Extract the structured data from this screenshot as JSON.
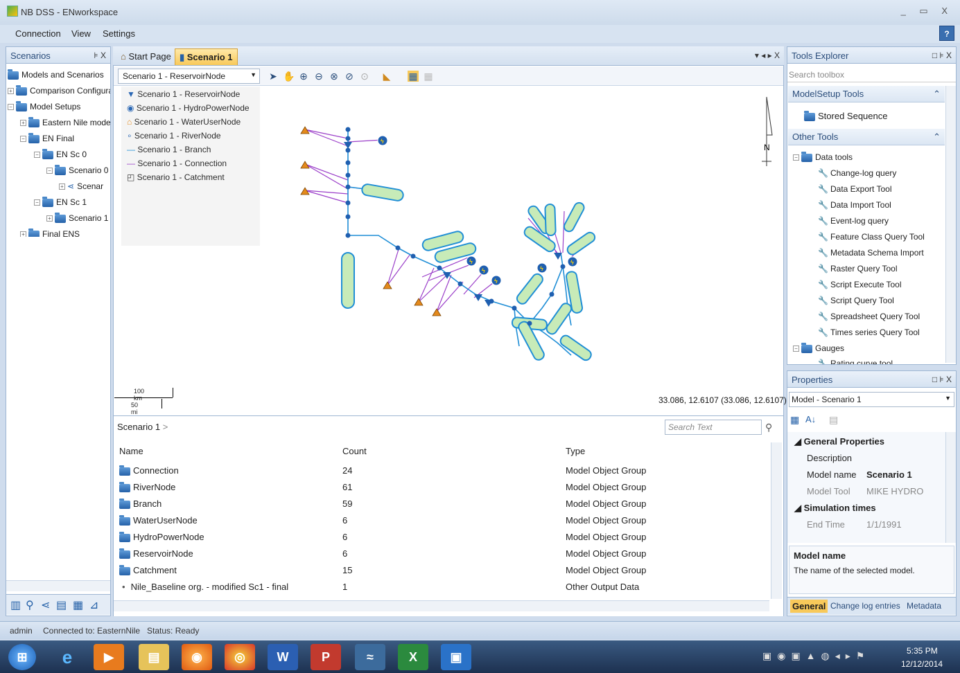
{
  "window": {
    "title": "NB DSS - ENworkspace",
    "controls": "_ ▭ X"
  },
  "menu": [
    "Connection",
    "View",
    "Settings"
  ],
  "help_label": "?",
  "scenarios_panel": {
    "title": "Scenarios",
    "pin": "⊧ X",
    "tree": [
      {
        "label": "Models and Scenarios"
      },
      {
        "label": "Comparison Configura"
      },
      {
        "label": "Model Setups"
      },
      {
        "label": "Eastern Nile mode"
      },
      {
        "label": "EN Final"
      },
      {
        "label": "EN Sc 0"
      },
      {
        "label": "Scenario 0"
      },
      {
        "label": "Scenar"
      },
      {
        "label": "EN Sc 1"
      },
      {
        "label": "Scenario 1"
      },
      {
        "label": "Final ENS"
      }
    ]
  },
  "tabs": {
    "start": "Start Page",
    "scenario": "Scenario 1"
  },
  "toolbar": {
    "layer_select": "Scenario 1 - ReservoirNode"
  },
  "legend": [
    {
      "icon": "reservoir-node-icon",
      "label": "Scenario 1 - ReservoirNode"
    },
    {
      "icon": "hydropower-node-icon",
      "label": "Scenario 1 - HydroPowerNode"
    },
    {
      "icon": "wateruser-node-icon",
      "label": "Scenario 1 - WaterUserNode"
    },
    {
      "icon": "river-node-icon",
      "label": "Scenario 1 - RiverNode"
    },
    {
      "icon": "branch-icon",
      "label": "Scenario 1 - Branch"
    },
    {
      "icon": "connection-icon",
      "label": "Scenario 1 - Connection"
    },
    {
      "icon": "catchment-icon",
      "label": "Scenario 1 - Catchment"
    }
  ],
  "map": {
    "north": "N",
    "scale_km": "100 km",
    "scale_mi": "50 mi",
    "coords": "33.086, 12.6107 (33.086, 12.6107)"
  },
  "list": {
    "breadcrumb": "Scenario 1",
    "breadcrumb_arrow": ">",
    "search_placeholder": "Search Text",
    "columns": {
      "name": "Name",
      "count": "Count",
      "type": "Type"
    },
    "rows": [
      {
        "name": "Connection",
        "count": "24",
        "type": "Model Object Group"
      },
      {
        "name": "RiverNode",
        "count": "61",
        "type": "Model Object Group"
      },
      {
        "name": "Branch",
        "count": "59",
        "type": "Model Object Group"
      },
      {
        "name": "WaterUserNode",
        "count": "6",
        "type": "Model Object Group"
      },
      {
        "name": "HydroPowerNode",
        "count": "6",
        "type": "Model Object Group"
      },
      {
        "name": "ReservoirNode",
        "count": "6",
        "type": "Model Object Group"
      },
      {
        "name": "Catchment",
        "count": "15",
        "type": "Model Object Group"
      },
      {
        "name": "Nile_Baseline org. - modified Sc1 - final",
        "count": "1",
        "type": "Other Output Data"
      }
    ]
  },
  "tools_explorer": {
    "title": "Tools Explorer",
    "controls": "□ ⊧ X",
    "search_placeholder": "Search toolbox",
    "modelsetup_header": "ModelSetup Tools",
    "stored_sequence": "Stored Sequence",
    "other_header": "Other Tools",
    "data_tools": "Data tools",
    "tools": [
      "Change-log query",
      "Data Export Tool",
      "Data Import Tool",
      "Event-log query",
      "Feature Class Query Tool",
      "Metadata Schema Import",
      "Raster Query Tool",
      "Script Execute Tool",
      "Script Query Tool",
      "Spreadsheet Query Tool",
      "Times series Query Tool"
    ],
    "gauges": "Gauges",
    "rating": "Rating curve tool"
  },
  "properties": {
    "title": "Properties",
    "controls": "□ ⊧ X",
    "selector": "Model - Scenario 1",
    "general_header": "General Properties",
    "description_label": "Description",
    "model_name_label": "Model name",
    "model_name_value": "Scenario 1",
    "model_tool_label": "Model Tool",
    "model_tool_value": "MIKE HYDRO",
    "sim_header": "Simulation times",
    "end_time_label": "End Time",
    "end_time_value": "1/1/1991",
    "desc_title": "Model name",
    "desc_text": "The name of the selected model.",
    "tabs": [
      "General",
      "Change log entries",
      "Metadata"
    ]
  },
  "status": {
    "user": "admin",
    "connected": "Connected to: EasternNile",
    "status": "Status: Ready"
  },
  "taskbar": {
    "time": "5:35 PM",
    "date": "12/12/2014"
  }
}
